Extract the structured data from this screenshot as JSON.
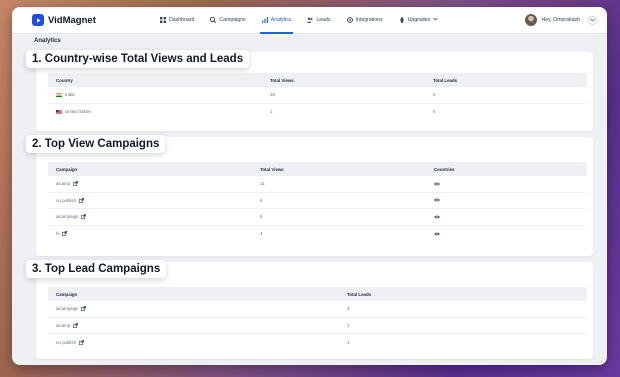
{
  "app": {
    "name": "VidMagnet"
  },
  "nav": {
    "items": [
      {
        "label": "Dashboard",
        "icon": "grid-icon"
      },
      {
        "label": "Campaigns",
        "icon": "campaign-icon"
      },
      {
        "label": "Analytics",
        "icon": "chart-icon",
        "active": true
      },
      {
        "label": "Leads",
        "icon": "users-icon"
      },
      {
        "label": "Integrations",
        "icon": "plug-icon"
      },
      {
        "label": "Upgrades",
        "icon": "rocket-icon"
      }
    ]
  },
  "user": {
    "greeting": "Hey, Omprakash"
  },
  "page": {
    "title": "Analytics"
  },
  "country_section": {
    "heading": "1. Country-wise Total Views and Leads",
    "columns": [
      "Country",
      "Total Views",
      "Total Leads"
    ],
    "rows": [
      {
        "country": "India",
        "flag": "india-flag",
        "views": "25",
        "leads": "6"
      },
      {
        "country": "United States",
        "flag": "us-flag",
        "views": "1",
        "leads": "0"
      }
    ]
  },
  "view_section": {
    "heading": "2. Top View Campaigns",
    "columns": [
      "Campaign",
      "Total Views",
      "Countries"
    ],
    "rows": [
      {
        "campaign": "aicamp",
        "views": "11"
      },
      {
        "campaign": "no publish",
        "views": "6"
      },
      {
        "campaign": "aicampaign",
        "views": "5"
      },
      {
        "campaign": "hi",
        "views": "4"
      }
    ]
  },
  "lead_section": {
    "heading": "3. Top Lead Campaigns",
    "columns": [
      "Campaign",
      "Total Leads"
    ],
    "rows": [
      {
        "campaign": "aicampaign",
        "leads": "4"
      },
      {
        "campaign": "aicamp",
        "leads": "1"
      },
      {
        "campaign": "no publish",
        "leads": "1"
      }
    ]
  },
  "colors": {
    "accent": "#1f5fd8",
    "header_bg": "#eef0f3",
    "page_bg": "#eef0f4"
  }
}
